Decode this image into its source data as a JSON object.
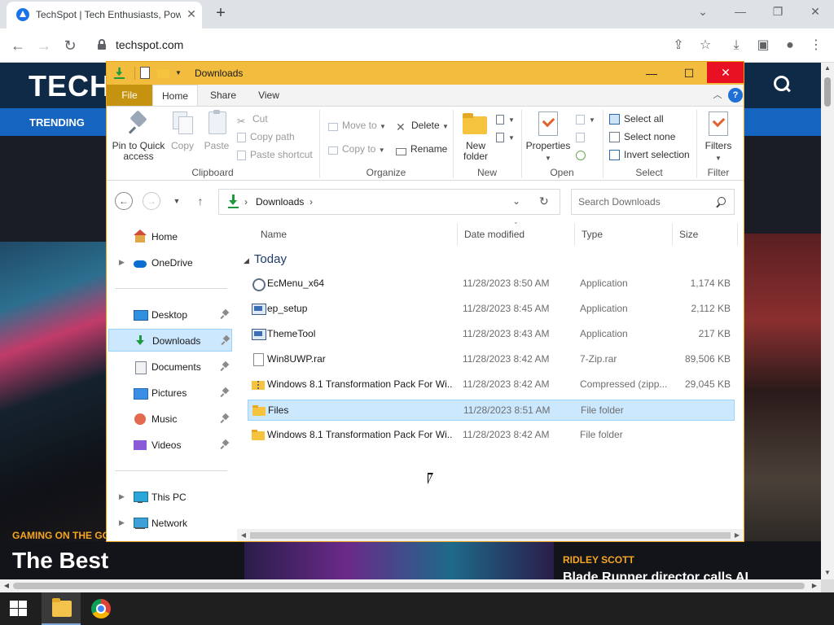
{
  "browser": {
    "tab_title": "TechSpot | Tech Enthusiasts, Pow",
    "tab_close": "✕",
    "new_tab": "+",
    "url": "techspot.com",
    "window_minimize": "—",
    "window_restore": "❐",
    "window_close": "✕",
    "window_dropdown": "⌄"
  },
  "site": {
    "logo": "TECH",
    "nav_trending": "TRENDING",
    "card1_tag": "GAMING ON THE GO",
    "card1_title": "The Best",
    "card2_tag": "RIDLEY SCOTT",
    "card2_title": "Blade Runner director calls AI"
  },
  "explorer": {
    "title": "Downloads",
    "tabs": {
      "file": "File",
      "home": "Home",
      "share": "Share",
      "view": "View"
    },
    "ribbon": {
      "clipboard": {
        "label": "Clipboard",
        "pin": "Pin to Quick access",
        "copy": "Copy",
        "paste": "Paste",
        "cut": "Cut",
        "copy_path": "Copy path",
        "paste_shortcut": "Paste shortcut"
      },
      "organize": {
        "label": "Organize",
        "move_to": "Move to",
        "copy_to": "Copy to",
        "delete": "Delete",
        "rename": "Rename"
      },
      "new": {
        "label": "New",
        "new_folder": "New folder"
      },
      "open": {
        "label": "Open",
        "properties": "Properties"
      },
      "select": {
        "label": "Select",
        "select_all": "Select all",
        "select_none": "Select none",
        "invert_selection": "Invert selection"
      },
      "filter": {
        "label": "Filter",
        "filters": "Filters"
      }
    },
    "address": {
      "crumb": "Downloads",
      "search_placeholder": "Search Downloads"
    },
    "nav": {
      "home": "Home",
      "onedrive": "OneDrive",
      "desktop": "Desktop",
      "downloads": "Downloads",
      "documents": "Documents",
      "pictures": "Pictures",
      "music": "Music",
      "videos": "Videos",
      "this_pc": "This PC",
      "network": "Network"
    },
    "columns": {
      "name": "Name",
      "date": "Date modified",
      "type": "Type",
      "size": "Size"
    },
    "group": "Today",
    "files": [
      {
        "name": "EcMenu_x64",
        "date": "11/28/2023 8:50 AM",
        "type": "Application",
        "size": "1,174 KB",
        "icon": "gear-app-icon"
      },
      {
        "name": "ep_setup",
        "date": "11/28/2023 8:45 AM",
        "type": "Application",
        "size": "2,112 KB",
        "icon": "application-icon"
      },
      {
        "name": "ThemeTool",
        "date": "11/28/2023 8:43 AM",
        "type": "Application",
        "size": "217 KB",
        "icon": "application-icon"
      },
      {
        "name": "Win8UWP.rar",
        "date": "11/28/2023 8:42 AM",
        "type": "7-Zip.rar",
        "size": "89,506 KB",
        "icon": "archive-file-icon"
      },
      {
        "name": "Windows 8.1 Transformation Pack For Wi...",
        "date": "11/28/2023 8:42 AM",
        "type": "Compressed (zipp...",
        "size": "29,045 KB",
        "icon": "zip-folder-icon"
      },
      {
        "name": "Files",
        "date": "11/28/2023 8:51 AM",
        "type": "File folder",
        "size": "",
        "icon": "folder-icon"
      },
      {
        "name": "Windows 8.1 Transformation Pack For Wi...",
        "date": "11/28/2023 8:42 AM",
        "type": "File folder",
        "size": "",
        "icon": "folder-icon"
      }
    ],
    "selected_file": "Files"
  },
  "colors": {
    "explorer_titlebar": "#f2bc3f",
    "file_tab": "#c5930f",
    "selection": "#cce8ff",
    "close_red": "#e81123",
    "site_nav": "#1565c0"
  }
}
